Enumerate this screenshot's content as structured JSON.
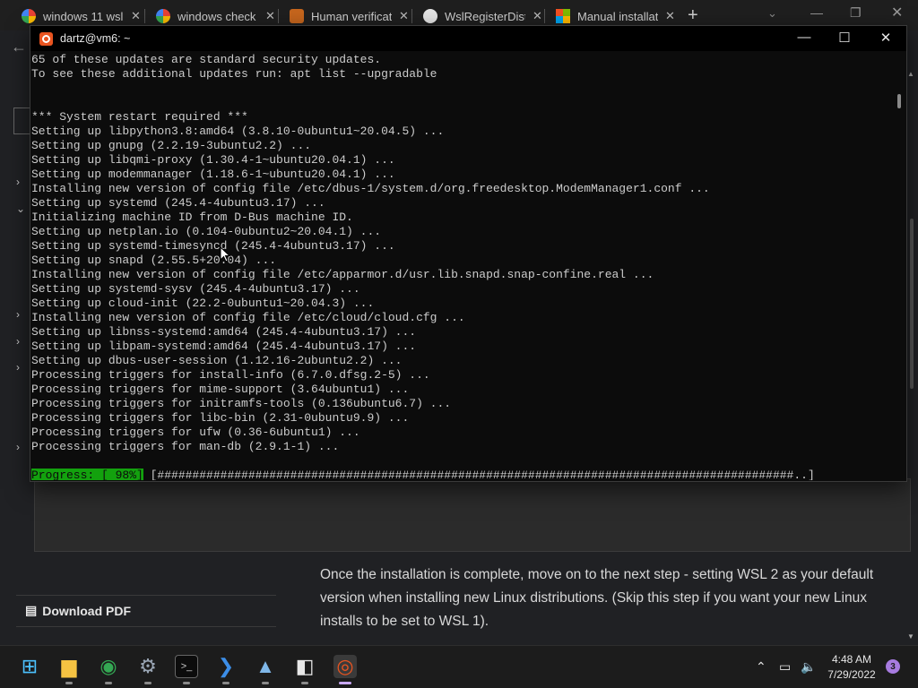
{
  "browser": {
    "tabs": [
      {
        "label": "windows 11 wsl",
        "favicon": "google-icon",
        "color": "#4285f4"
      },
      {
        "label": "windows check",
        "favicon": "google-icon",
        "color": "#4285f4"
      },
      {
        "label": "Human verificat",
        "favicon": "cloudflare-icon",
        "color": "#c7661d"
      },
      {
        "label": "WslRegisterDist",
        "favicon": "github-icon",
        "color": "#e6e6e6"
      },
      {
        "label": "Manual installat",
        "favicon": "microsoft-icon",
        "color": "#f25022"
      }
    ],
    "close_glyph": "✕",
    "new_tab_glyph": "+",
    "tab_search_glyph": "⌄",
    "minimize_glyph": "—",
    "restore_glyph": "❐",
    "close_window_glyph": "✕",
    "back_glyph": "←"
  },
  "page": {
    "article_text": "Once the installation is complete, move on to the next step - setting WSL 2 as your default version when installing new Linux distributions. (Skip this step if you want your new Linux installs to be set to WSL 1).",
    "download_pdf_label": "Download PDF",
    "pdf_icon": "▤"
  },
  "terminal": {
    "title": "dartz@vm6: ~",
    "minimize_glyph": "—",
    "maximize_glyph": "☐",
    "close_glyph": "✕",
    "lines": [
      "65 of these updates are standard security updates.",
      "To see these additional updates run: apt list --upgradable",
      "",
      "",
      "*** System restart required ***",
      "Setting up libpython3.8:amd64 (3.8.10-0ubuntu1~20.04.5) ...",
      "Setting up gnupg (2.2.19-3ubuntu2.2) ...",
      "Setting up libqmi-proxy (1.30.4-1~ubuntu20.04.1) ...",
      "Setting up modemmanager (1.18.6-1~ubuntu20.04.1) ...",
      "Installing new version of config file /etc/dbus-1/system.d/org.freedesktop.ModemManager1.conf ...",
      "Setting up systemd (245.4-4ubuntu3.17) ...",
      "Initializing machine ID from D-Bus machine ID.",
      "Setting up netplan.io (0.104-0ubuntu2~20.04.1) ...",
      "Setting up systemd-timesyncd (245.4-4ubuntu3.17) ...",
      "Setting up snapd (2.55.5+20.04) ...",
      "Installing new version of config file /etc/apparmor.d/usr.lib.snapd.snap-confine.real ...",
      "Setting up systemd-sysv (245.4-4ubuntu3.17) ...",
      "Setting up cloud-init (22.2-0ubuntu1~20.04.3) ...",
      "Installing new version of config file /etc/cloud/cloud.cfg ...",
      "Setting up libnss-systemd:amd64 (245.4-4ubuntu3.17) ...",
      "Setting up libpam-systemd:amd64 (245.4-4ubuntu3.17) ...",
      "Setting up dbus-user-session (1.12.16-2ubuntu2.2) ...",
      "Processing triggers for install-info (6.7.0.dfsg.2-5) ...",
      "Processing triggers for mime-support (3.64ubuntu1) ...",
      "Processing triggers for initramfs-tools (0.136ubuntu6.7) ...",
      "Processing triggers for libc-bin (2.31-0ubuntu9.9) ...",
      "Processing triggers for ufw (0.36-6ubuntu1) ...",
      "Processing triggers for man-db (2.9.1-1) ...",
      ""
    ],
    "progress_label": "Progress: [ 98%]",
    "progress_bar": " [###########################################################################################..]",
    "progress_color": "#13a10e"
  },
  "taskbar": {
    "apps": [
      {
        "name": "start-menu-icon",
        "glyph": "⊞",
        "color": "#4cc2ff"
      },
      {
        "name": "file-explorer-icon",
        "glyph": "▆",
        "color": "#f6c342"
      },
      {
        "name": "chrome-icon",
        "glyph": "◉",
        "color": "#34a853"
      },
      {
        "name": "settings-icon",
        "glyph": "⚙",
        "color": "#9aa6b5"
      },
      {
        "name": "terminal-icon",
        "glyph": ">_",
        "color": "#cccccc"
      },
      {
        "name": "powershell-icon",
        "glyph": "❯",
        "color": "#3c8ee8"
      },
      {
        "name": "photos-icon",
        "glyph": "▲",
        "color": "#7fb7e8"
      },
      {
        "name": "store-icon",
        "glyph": "◧",
        "color": "#e8e8e8"
      },
      {
        "name": "ubuntu-icon",
        "glyph": "◎",
        "color": "#e95420"
      }
    ],
    "tray_chevron": "⌃",
    "network_icon": "▭",
    "volume_icon": "🔈",
    "time": "4:48 AM",
    "date": "7/29/2022",
    "notification_count": "3",
    "notification_color": "#a77be0"
  }
}
